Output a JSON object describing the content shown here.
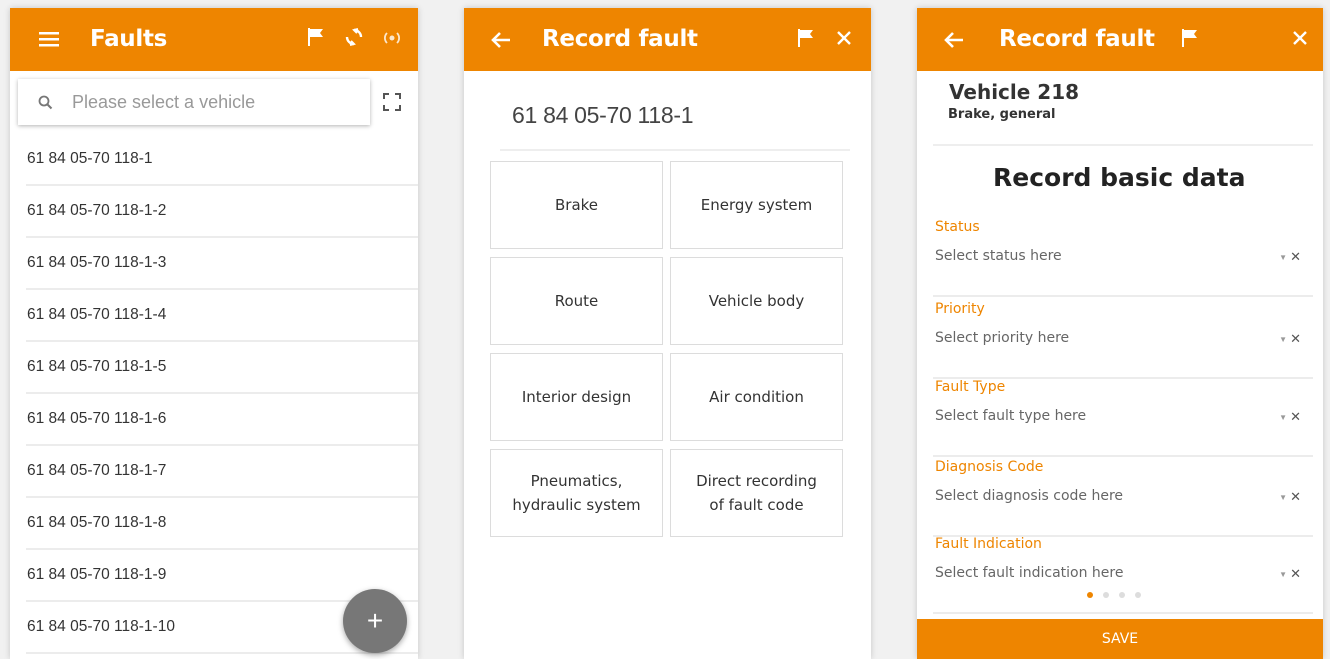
{
  "screen_list": {
    "title": "Faults",
    "search_placeholder": "Please select a vehicle",
    "vehicles": [
      "61 84 05-70 118-1",
      "61 84 05-70 118-1-2",
      "61 84 05-70 118-1-3",
      "61 84 05-70 118-1-4",
      "61 84 05-70 118-1-5",
      "61 84 05-70 118-1-6",
      "61 84 05-70 118-1-7",
      "61 84 05-70 118-1-8",
      "61 84 05-70 118-1-9",
      "61 84 05-70 118-1-10"
    ],
    "fab_label": "+"
  },
  "screen_categories": {
    "title": "Record fault",
    "vehicle_number": "61 84 05-70 118-1",
    "categories": [
      "Brake",
      "Energy system",
      "Route",
      "Vehicle body",
      "Interior design",
      "Air condition",
      "Pneumatics,\nhydraulic system",
      "Direct recording\nof fault code"
    ]
  },
  "screen_form": {
    "title": "Record fault",
    "vehicle": "Vehicle 218",
    "category": "Brake, general",
    "section_title": "Record basic data",
    "fields": [
      {
        "label": "Status",
        "placeholder": "Select status here"
      },
      {
        "label": "Priority",
        "placeholder": "Select priority here"
      },
      {
        "label": "Fault Type",
        "placeholder": "Select fault type here"
      },
      {
        "label": "Diagnosis Code",
        "placeholder": "Select diagnosis code here"
      },
      {
        "label": "Fault Indication",
        "placeholder": "Select fault indication here"
      }
    ],
    "pager": {
      "pages": 4,
      "active": 1
    },
    "save_label": "SAVE"
  },
  "colors": {
    "accent": "#ee8500",
    "fab": "#777777"
  },
  "icons": [
    "menu-icon",
    "flag-icon",
    "sync-icon",
    "nfc-icon",
    "search-icon",
    "fullscreen-icon",
    "back-arrow-icon",
    "close-icon",
    "dropdown-caret-icon",
    "clear-icon"
  ]
}
